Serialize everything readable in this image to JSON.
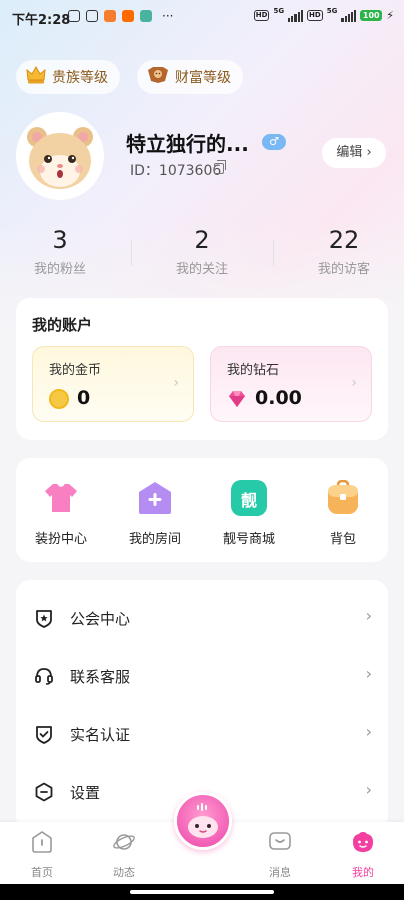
{
  "status_bar": {
    "time": "下午2:28",
    "signal1": "5G",
    "signal2": "5G",
    "hd1": "HD",
    "hd2": "HD",
    "battery": "100",
    "more": "···"
  },
  "levels": {
    "noble": "贵族等级",
    "wealth": "财富等级"
  },
  "profile": {
    "nickname": "特立独行的...",
    "gender_symbol": "♂",
    "id_label": "ID：",
    "id": "1073606",
    "edit": "编辑 ›"
  },
  "stats": [
    {
      "value": "3",
      "label": "我的粉丝"
    },
    {
      "value": "2",
      "label": "我的关注"
    },
    {
      "value": "22",
      "label": "我的访客"
    }
  ],
  "account": {
    "title": "我的账户",
    "coins_label": "我的金币",
    "coins_value": "0",
    "diamonds_label": "我的钻石",
    "diamonds_value": "0.00",
    "chevron": "›"
  },
  "grid": [
    {
      "label": "装扮中心",
      "icon": "shirt-icon",
      "color": "#f77fc2"
    },
    {
      "label": "我的房间",
      "icon": "house-plus-icon",
      "color": "#b58cf2"
    },
    {
      "label": "靓号商城",
      "icon": "liang-badge-icon",
      "color": "#26c9a8",
      "glyph": "靓"
    },
    {
      "label": "背包",
      "icon": "backpack-icon",
      "color": "#f7b35a"
    }
  ],
  "list": [
    {
      "label": "公会中心",
      "icon": "shield-star-icon"
    },
    {
      "label": "联系客服",
      "icon": "headset-icon"
    },
    {
      "label": "实名认证",
      "icon": "shield-check-icon"
    },
    {
      "label": "设置",
      "icon": "settings-icon"
    }
  ],
  "list_chevron": "›",
  "nav": [
    {
      "label": "首页",
      "icon": "home-icon"
    },
    {
      "label": "动态",
      "icon": "planet-icon"
    },
    {
      "label": "消息",
      "icon": "message-icon"
    },
    {
      "label": "我的",
      "icon": "profile-face-icon"
    }
  ],
  "colors": {
    "accent": "#f23fa0",
    "coin": "#f6c944",
    "diamond": "#f0509a"
  }
}
